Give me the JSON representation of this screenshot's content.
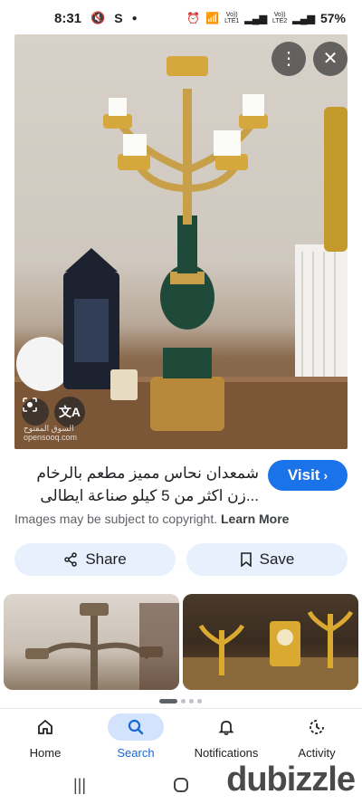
{
  "status_bar": {
    "time": "8:31",
    "net1": "Vo))",
    "net1_sub": "LTE1",
    "net2": "Vo))",
    "net2_sub": "LTE2",
    "battery": "57%"
  },
  "hero": {
    "more_icon": "more-vert-icon",
    "close_icon": "close-icon",
    "watermark_line1": "السوق المفتوح",
    "watermark_line2": "opensooq.com"
  },
  "result": {
    "title_line1": "شمعدان نحاس مميز مطعم بالرخام",
    "title_line2": "...زن اكثر من 5 كيلو صناعة ايطالى",
    "visit_label": "Visit",
    "copyright_text": "Images may be subject to copyright.",
    "learn_more": "Learn More"
  },
  "actions": {
    "share_label": "Share",
    "save_label": "Save"
  },
  "bottom_nav": {
    "items": [
      {
        "label": "Home",
        "icon": "home-icon"
      },
      {
        "label": "Search",
        "icon": "search-icon"
      },
      {
        "label": "Notifications",
        "icon": "bell-icon"
      },
      {
        "label": "Activity",
        "icon": "activity-icon"
      }
    ]
  },
  "brand": {
    "dubizzle": "dubizzle"
  },
  "colors": {
    "accent": "#1a73e8",
    "pill": "#e8f0fe",
    "nav_active": "#d3e3fd"
  }
}
